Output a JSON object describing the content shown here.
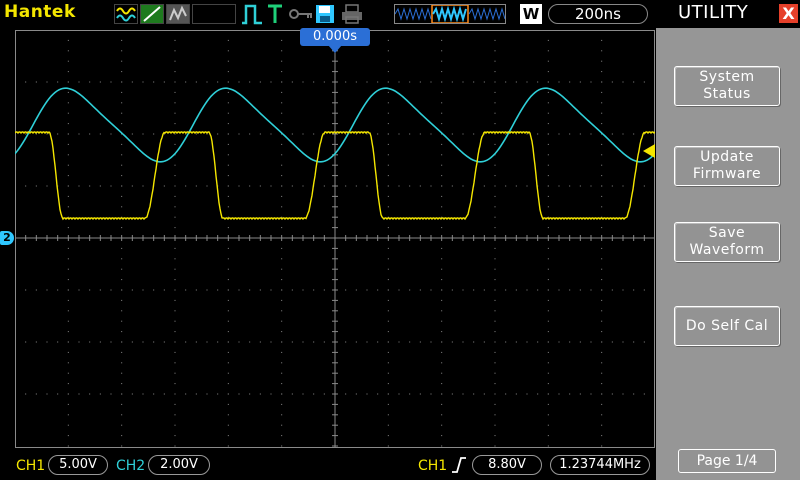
{
  "brand": "Hantek",
  "timebase": "200ns",
  "acquire_mode": "W",
  "trigger_time": "0.000s",
  "ch2_marker": "2",
  "menu": {
    "title": "UTILITY",
    "close": "X",
    "items": [
      {
        "label": "System\nStatus"
      },
      {
        "label": "Update\nFirmware"
      },
      {
        "label": "Save\nWaveform"
      },
      {
        "label": "Do Self Cal"
      }
    ],
    "page": "Page 1/4"
  },
  "status": {
    "ch1_label": "CH1",
    "ch1_scale": "5.00V",
    "ch2_label": "CH2",
    "ch2_scale": "2.00V",
    "trig_source": "CH1",
    "trig_level": "8.80V",
    "frequency": "1.23744MHz"
  },
  "colors": {
    "ch1": "#f4e600",
    "ch2": "#2fd0d8",
    "grid": "#8a8a8a",
    "accent": "#2b6fd6",
    "menu_bg": "#969696"
  },
  "icons": [
    "waveform-display-icon",
    "vector-icon",
    "persistence-icon",
    "run-stop-icon",
    "trigger-icon",
    "lock-icon",
    "save-disk-icon",
    "print-icon",
    "memory-window-icon"
  ]
}
